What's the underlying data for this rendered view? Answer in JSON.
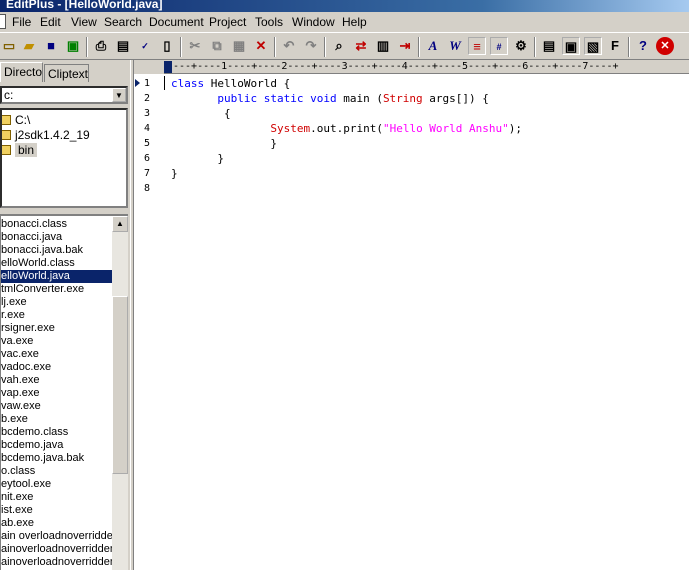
{
  "window": {
    "title": "EditPlus - [HelloWorld.java]"
  },
  "menu": [
    "File",
    "Edit",
    "View",
    "Search",
    "Document",
    "Project",
    "Tools",
    "Window",
    "Help"
  ],
  "toolbar_icons": [
    "new-icon",
    "open-icon",
    "save-icon",
    "save-all-icon",
    "print-preview-icon",
    "print-icon",
    "spell-check-icon",
    "html-preview-icon",
    "cut-icon",
    "copy-icon",
    "paste-icon",
    "delete-icon",
    "undo-icon",
    "redo-icon",
    "find-icon",
    "replace-icon",
    "copy-file-icon",
    "split-icon",
    "font-icon",
    "word-wrap-icon",
    "ruler-icon",
    "line-number-icon",
    "settings-icon",
    "doc-selector-icon",
    "output-window-icon",
    "cliptext-icon",
    "directory-icon",
    "help-icon",
    "close-icon"
  ],
  "tabs": {
    "directory": "Directory",
    "cliptext": "Cliptext"
  },
  "drive": "c:",
  "dirtree": [
    "C:\\",
    "j2sdk1.4.2_19",
    "bin"
  ],
  "files": [
    "bonacci.class",
    "bonacci.java",
    "bonacci.java.bak",
    "elloWorld.class",
    "elloWorld.java",
    "tmlConverter.exe",
    "lj.exe",
    "r.exe",
    "rsigner.exe",
    "va.exe",
    "vac.exe",
    "vadoc.exe",
    "vah.exe",
    "vap.exe",
    "vaw.exe",
    "b.exe",
    "bcdemo.class",
    "bcdemo.java",
    "bcdemo.java.bak",
    "o.class",
    "eytool.exe",
    "nit.exe",
    "ist.exe",
    "ab.exe",
    "ain overloadnoverridder",
    "ainoverloadnoverridden",
    "ainoverloadnoverridden"
  ],
  "selected_file": "elloWorld.java",
  "ruler": "---+----1----+----2----+----3----+----4----+----5----+----6----+----7----+",
  "line_numbers": [
    "1",
    "2",
    "3",
    "4",
    "5",
    "6",
    "7",
    "8"
  ],
  "code": [
    [
      [
        "kw",
        "class"
      ],
      [
        "plain",
        " HelloWorld {"
      ]
    ],
    [
      [
        "plain",
        "       "
      ],
      [
        "kw",
        "public static void"
      ],
      [
        "plain",
        " main ("
      ],
      [
        "ty",
        "String"
      ],
      [
        "plain",
        " args[]) {"
      ]
    ],
    [
      [
        "plain",
        "        {"
      ]
    ],
    [
      [
        "plain",
        "               "
      ],
      [
        "ty",
        "System"
      ],
      [
        "plain",
        ".out.print("
      ],
      [
        "str",
        "\"Hello World Anshu\""
      ],
      [
        "plain",
        ");"
      ]
    ],
    [
      [
        "plain",
        "               }"
      ]
    ],
    [
      [
        "plain",
        "       }"
      ]
    ],
    [
      [
        "plain",
        "}"
      ]
    ],
    [
      [
        "plain",
        ""
      ]
    ]
  ]
}
